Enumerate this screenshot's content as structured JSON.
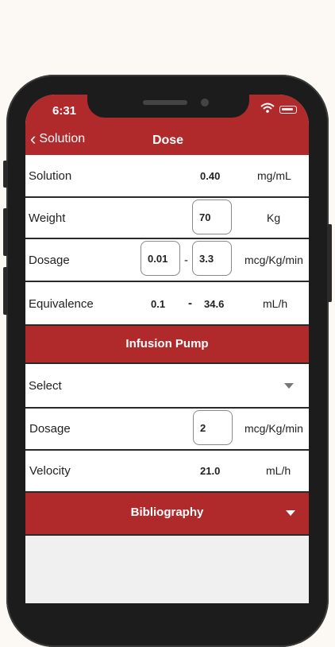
{
  "status": {
    "time": "6:31"
  },
  "nav": {
    "back_label": "Solution",
    "title": "Dose"
  },
  "rows": {
    "solution": {
      "label": "Solution",
      "value": "0.40",
      "unit": "mg/mL"
    },
    "weight": {
      "label": "Weight",
      "value": "70",
      "unit": "Kg"
    },
    "dosage": {
      "label": "Dosage",
      "min": "0.01",
      "sep": "-",
      "max": "3.3",
      "unit": "mcg/Kg/min"
    },
    "equivalence": {
      "label": "Equivalence",
      "min": "0.1",
      "sep": "-",
      "max": "34.6",
      "unit": "mL/h"
    }
  },
  "infusion": {
    "header": "Infusion Pump",
    "select_label": "Select",
    "dosage": {
      "label": "Dosage",
      "value": "2",
      "unit": "mcg/Kg/min"
    },
    "velocity": {
      "label": "Velocity",
      "value": "21.0",
      "unit": "mL/h"
    }
  },
  "bibliography": {
    "label": "Bibliography"
  },
  "colors": {
    "accent": "#b12a2b",
    "border": "#2a2a2a"
  }
}
